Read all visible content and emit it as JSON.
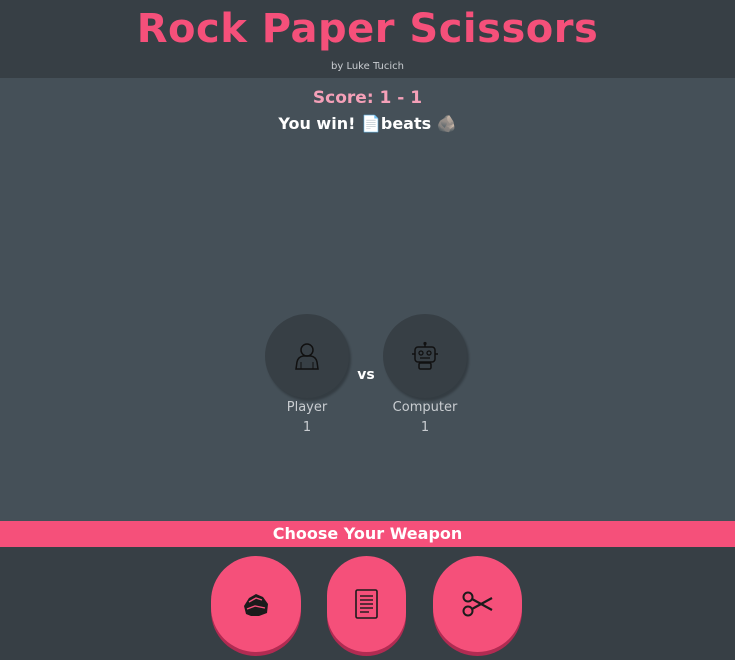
{
  "header": {
    "title": "Rock Paper Scissors",
    "byline": "by Luke Tucich"
  },
  "status": {
    "score": "Score: 1 - 1",
    "result": "You win! 📄beats 🪨"
  },
  "arena": {
    "player": {
      "label": "Player",
      "score": "1",
      "icon": "person-icon"
    },
    "vs": "vs",
    "computer": {
      "label": "Computer",
      "score": "1",
      "icon": "robot-icon"
    }
  },
  "weapons": {
    "heading": "Choose Your Weapon",
    "options": [
      {
        "name": "rock",
        "icon": "rock-icon"
      },
      {
        "name": "paper",
        "icon": "paper-icon"
      },
      {
        "name": "scissors",
        "icon": "scissors-icon"
      }
    ]
  },
  "colors": {
    "accent": "#f5507a",
    "header_bg": "#373f45",
    "page_bg": "#455058"
  }
}
